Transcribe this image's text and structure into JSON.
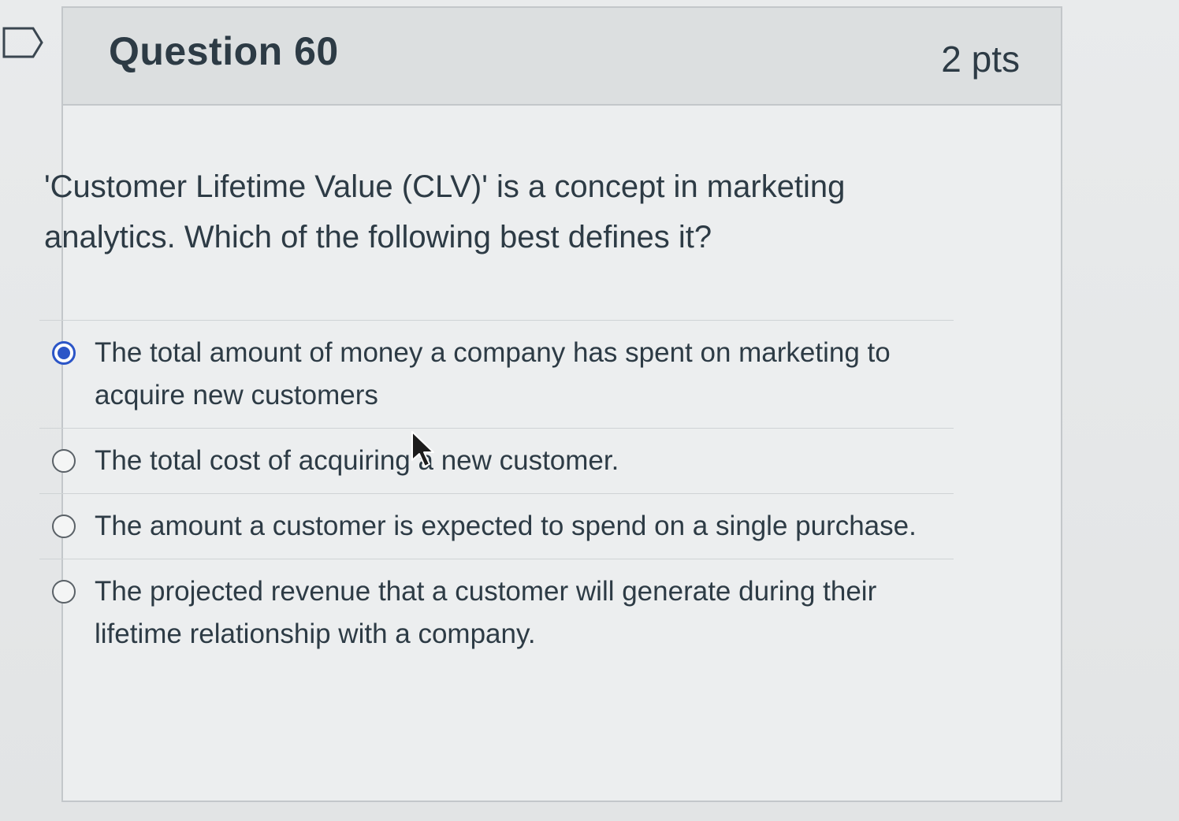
{
  "question": {
    "title": "Question 60",
    "points": "2 pts",
    "text": "'Customer Lifetime Value (CLV)' is a concept in marketing analytics. Which of the following best defines it?"
  },
  "answers": [
    {
      "label": "The total amount of money a company has spent on marketing to acquire new customers",
      "selected": true
    },
    {
      "label": "The total cost of acquiring a new customer.",
      "selected": false
    },
    {
      "label": "The amount a customer is expected to spend on a single purchase.",
      "selected": false
    },
    {
      "label": "The projected revenue that a customer will generate during their lifetime relationship with a company.",
      "selected": false
    }
  ],
  "icons": {
    "flag": "flag-icon",
    "cursor": "mouse-pointer-icon"
  },
  "colors": {
    "radio_selected": "#2b55c7",
    "text": "#2d3b45",
    "header_bg": "#dcdfe0"
  }
}
